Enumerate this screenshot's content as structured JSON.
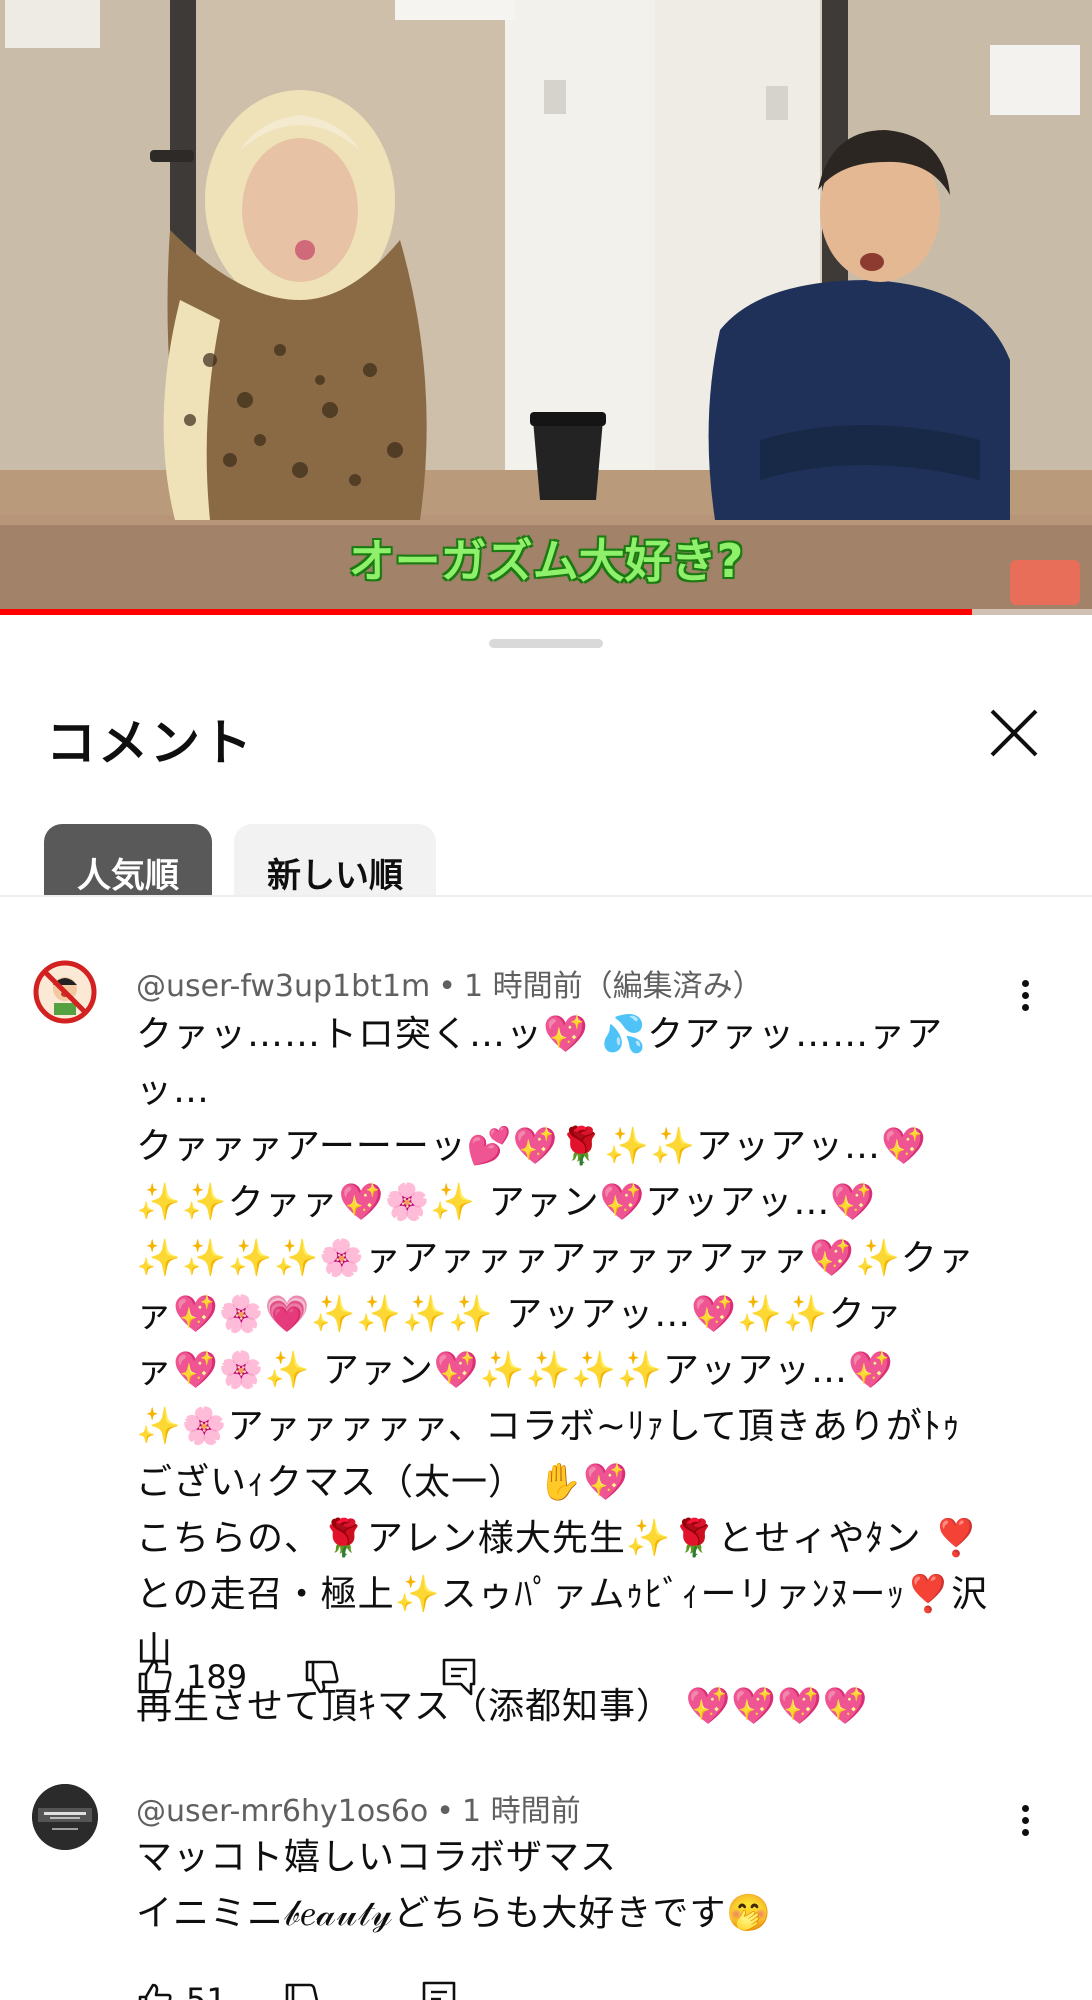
{
  "video": {
    "caption": "オーガズム大好き?",
    "progress_fraction": 0.89
  },
  "sheet": {
    "title": "コメント",
    "close_icon": "close-icon",
    "sort_chips": [
      {
        "label": "人気順",
        "selected": true
      },
      {
        "label": "新しい順",
        "selected": false
      }
    ]
  },
  "comments": [
    {
      "author": "@user-fw3up1bt1m",
      "time": "1 時間前（編集済み）",
      "text": "クァッ……トロ突く…ッ💖 💦クアァッ……ァアッ…\nクァァァアーーーッ💕💖🌹✨✨アッアッ…💖\n✨✨クァァ💖🌸✨ アァン💖アッアッ…💖\n✨✨✨✨🌸ァアァァァアァァァアァァ💖✨クァ\nァ💖🌸💗✨✨✨✨ アッアッ…💖✨✨クァ\nァ💖🌸✨ アァン💖✨✨✨✨アッアッ…💖\n✨🌸アァァァァァ、コラボ~ﾘｧして頂きありがﾄｩ\nございｨクマス（太一） ✋💖\nこちらの、🌹アレン様大先生✨🌹とせィやﾀン ❣️\nとの走召・極上✨スゥﾊﾟァムｩﾋﾞｨーリァﾝﾇーｯ❣️沢山\n再生させて頂ｷマス（添都知事） 💖💖💖💖",
      "likes": "189",
      "avatar_icon": "no-smoking-avatar-icon"
    },
    {
      "author": "@user-mr6hy1os6o",
      "time": "1 時間前",
      "text": "マッコト嬉しいコラボザマス\nイニミニ𝒷𝑒𝒶𝓊𝓉𝓎どちらも大好きです🤭",
      "likes": "51",
      "avatar_icon": "discover-logo-avatar-icon"
    }
  ],
  "colors": {
    "accent_red": "#ff0000",
    "chip_active": "#595959",
    "chip_inactive": "#f2f2f2",
    "meta_text": "#606060"
  }
}
